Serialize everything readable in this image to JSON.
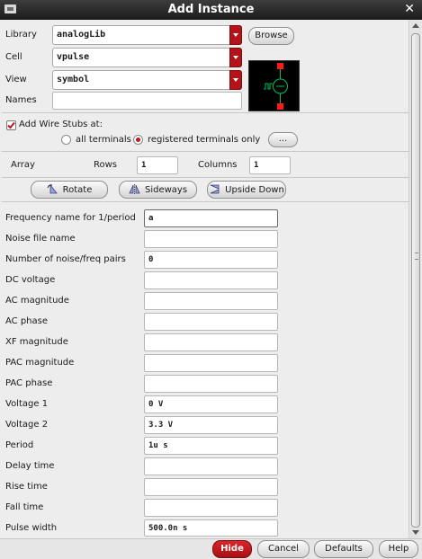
{
  "window": {
    "title": "Add Instance"
  },
  "library": {
    "label": "Library",
    "value": "analogLib",
    "browse_label": "Browse"
  },
  "cell": {
    "label": "Cell",
    "value": "vpulse"
  },
  "view": {
    "label": "View",
    "value": "symbol"
  },
  "names": {
    "label": "Names",
    "value": ""
  },
  "wire_stubs": {
    "label": "Add Wire Stubs at:",
    "checked": true,
    "options": [
      {
        "label": "all terminals",
        "selected": false
      },
      {
        "label": "registered terminals only",
        "selected": true
      }
    ],
    "more_label": "..."
  },
  "array": {
    "label": "Array",
    "rows_label": "Rows",
    "rows_value": "1",
    "columns_label": "Columns",
    "columns_value": "1"
  },
  "transform": {
    "rotate_label": "Rotate",
    "sideways_label": "Sideways",
    "upside_down_label": "Upside Down"
  },
  "params": [
    {
      "label": "Frequency name for 1/period",
      "value": "a"
    },
    {
      "label": "Noise file name",
      "value": ""
    },
    {
      "label": "Number of noise/freq pairs",
      "value": "0"
    },
    {
      "label": "DC voltage",
      "value": ""
    },
    {
      "label": "AC magnitude",
      "value": ""
    },
    {
      "label": "AC phase",
      "value": ""
    },
    {
      "label": "XF magnitude",
      "value": ""
    },
    {
      "label": "PAC magnitude",
      "value": ""
    },
    {
      "label": "PAC phase",
      "value": ""
    },
    {
      "label": "Voltage 1",
      "value": "0 V"
    },
    {
      "label": "Voltage 2",
      "value": "3.3 V"
    },
    {
      "label": "Period",
      "value": "1u s"
    },
    {
      "label": "Delay time",
      "value": ""
    },
    {
      "label": "Rise time",
      "value": ""
    },
    {
      "label": "Fall time",
      "value": ""
    },
    {
      "label": "Pulse width",
      "value": "500.0n s"
    }
  ],
  "footer": {
    "hide_label": "Hide",
    "cancel_label": "Cancel",
    "defaults_label": "Defaults",
    "help_label": "Help"
  },
  "colors": {
    "accent": "#b3141a",
    "titlebar": "#2a2a2a",
    "background": "#ededed"
  }
}
